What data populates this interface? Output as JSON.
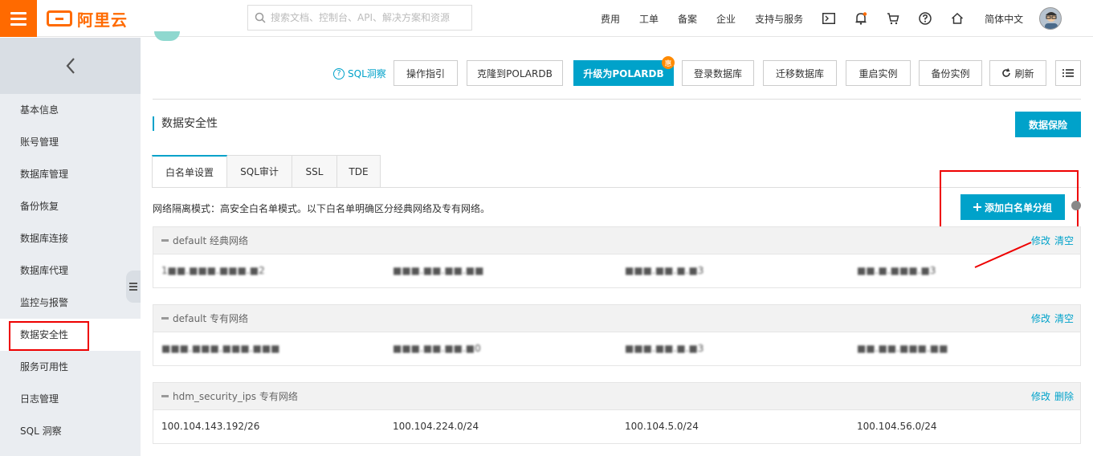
{
  "topbar": {
    "brand": "阿里云",
    "search_placeholder": "搜索文档、控制台、API、解决方案和资源",
    "nav": [
      "费用",
      "工单",
      "备案",
      "企业",
      "支持与服务"
    ],
    "icons": [
      "terminal-icon",
      "bell-icon",
      "cart-icon",
      "help-icon",
      "home-icon"
    ],
    "language": "简体中文"
  },
  "sidebar": {
    "items": [
      "基本信息",
      "账号管理",
      "数据库管理",
      "备份恢复",
      "数据库连接",
      "数据库代理",
      "监控与报警",
      "数据安全性",
      "服务可用性",
      "日志管理",
      "SQL 洞察"
    ],
    "active_index": 7
  },
  "toolbar": {
    "sql_help": "SQL洞察",
    "buttons": [
      "操作指引",
      "克隆到POLARDB",
      "升级为POLARDB",
      "登录数据库",
      "迁移数据库",
      "重启实例",
      "备份实例",
      "刷新"
    ],
    "new_badge": "惠"
  },
  "section": {
    "title": "数据安全性",
    "protect_button": "数据保险"
  },
  "tabs": [
    "白名单设置",
    "SQL审计",
    "SSL",
    "TDE"
  ],
  "whitelist": {
    "network_mode": "网络隔离模式：高安全白名单模式。以下白名单明确区分经典网络及专有网络。",
    "add_group_button": "添加白名单分组",
    "groups": [
      {
        "name": "default 经典网络",
        "actions": [
          "修改",
          "清空"
        ],
        "ips": [
          "1■■.■■■.■■■.■2",
          "■■■.■■.■■.■■",
          "■■■.■■.■.■3",
          "■■.■.■■■.■3"
        ],
        "masked": true
      },
      {
        "name": "default 专有网络",
        "actions": [
          "修改",
          "清空"
        ],
        "ips": [
          "■■■.■■■.■■■.■■■",
          "■■■.■■.■■.■0",
          "■■■.■■.■.■3",
          "■■.■■.■■■.■■"
        ],
        "masked": true
      },
      {
        "name": "hdm_security_ips 专有网络",
        "actions": [
          "修改",
          "删除"
        ],
        "ips": [
          "100.104.143.192/26",
          "100.104.224.0/24",
          "100.104.5.0/24",
          "100.104.56.0/24"
        ],
        "masked": false
      }
    ]
  },
  "colors": {
    "accent": "#00a2ca",
    "brand": "#ff6a00",
    "annotation": "#e00000"
  }
}
